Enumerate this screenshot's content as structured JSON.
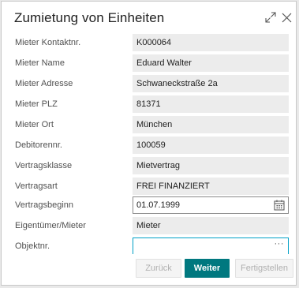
{
  "dialog": {
    "title": "Zumietung von Einheiten",
    "expand_icon": "expand-icon",
    "close_icon": "close-icon"
  },
  "fields": [
    {
      "label": "Mieter Kontaktnr.",
      "value": "K000064"
    },
    {
      "label": "Mieter Name",
      "value": "Eduard Walter"
    },
    {
      "label": "Mieter Adresse",
      "value": "Schwaneckstraße 2a"
    },
    {
      "label": "Mieter PLZ",
      "value": "81371"
    },
    {
      "label": "Mieter Ort",
      "value": "München"
    },
    {
      "label": "Debitorennr.",
      "value": "100059"
    },
    {
      "label": "Vertragsklasse",
      "value": "Mietvertrag"
    },
    {
      "label": "Vertragsart",
      "value": "FREI FINANZIERT"
    },
    {
      "label": "Vertragsbeginn",
      "value": "01.07.1999",
      "icon": "calendar-icon"
    },
    {
      "label": "Eigentümer/Mieter",
      "value": "Mieter"
    },
    {
      "label": "Objektnr.",
      "value": "",
      "icon": "ellipsis-icon",
      "ellipsis": "···"
    }
  ],
  "buttons": {
    "back": "Zurück",
    "next": "Weiter",
    "finish": "Fertigstellen"
  },
  "colors": {
    "primary": "#00787f",
    "focus_border": "#00a0c6",
    "readonly_bg": "#ececec"
  }
}
